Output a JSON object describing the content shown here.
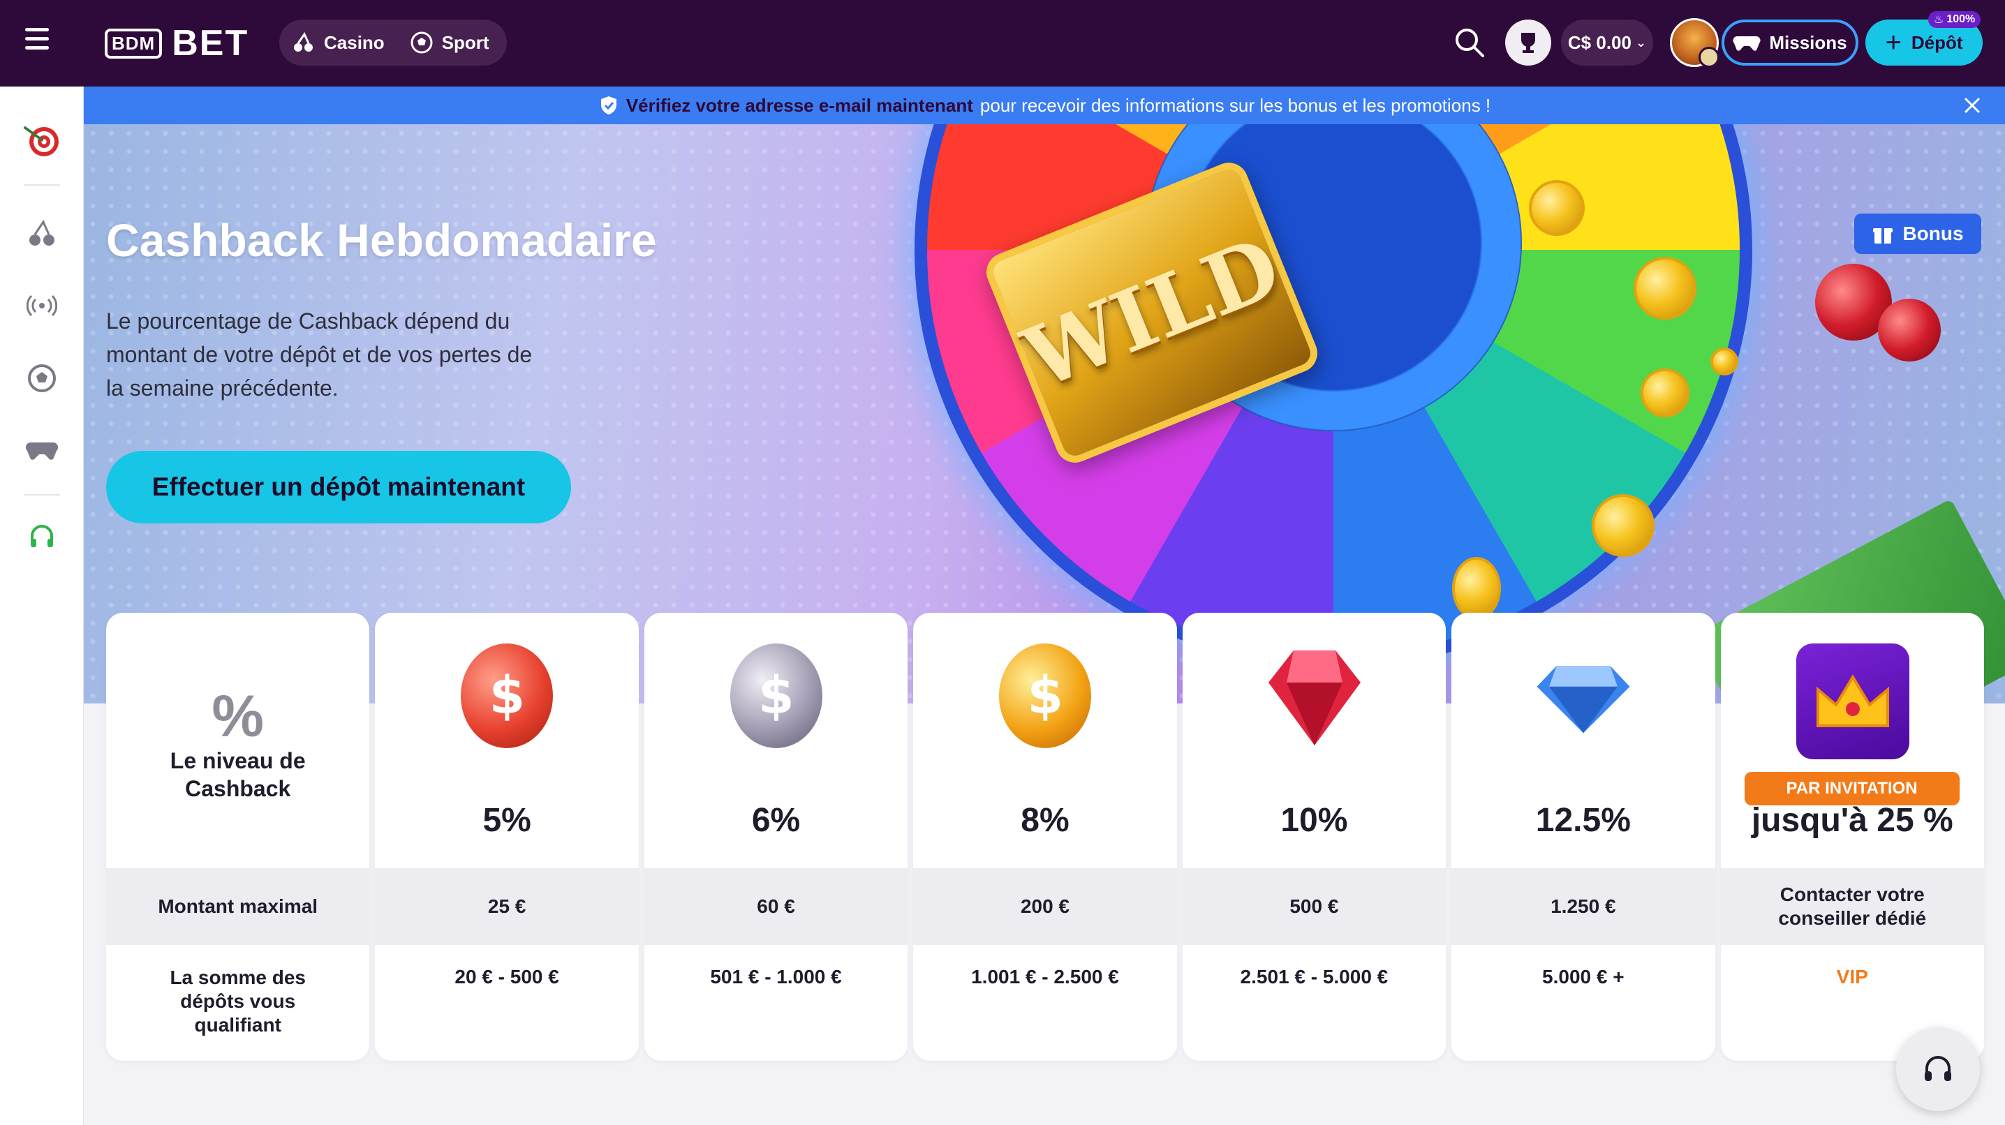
{
  "header": {
    "logo_box": "BDM",
    "logo_text": "BET",
    "nav": [
      {
        "label": "Casino",
        "icon": "cherry-icon"
      },
      {
        "label": "Sport",
        "icon": "soccer-ball-icon"
      }
    ],
    "balance": "C$ 0.00",
    "missions_label": "Missions",
    "deposit_label": "Dépôt",
    "deposit_badge": "100%"
  },
  "sidebar": {
    "items": [
      {
        "icon": "target-darts-icon"
      },
      {
        "icon": "cherry-icon"
      },
      {
        "icon": "live-broadcast-icon"
      },
      {
        "icon": "soccer-ball-icon"
      },
      {
        "icon": "gamepad-icon"
      },
      {
        "icon": "headset-icon"
      }
    ]
  },
  "notice": {
    "bold": "Vérifiez votre adresse e-mail maintenant",
    "text": "pour recevoir des informations sur les bonus et les promotions !"
  },
  "hero": {
    "title": "Cashback Hebdomadaire",
    "description": "Le pourcentage de Cashback dépend du montant de votre dépôt et de vos pertes de la semaine précédente.",
    "cta": "Effectuer un dépôt maintenant",
    "bonus_label": "Bonus",
    "wild_text": "WILD"
  },
  "table": {
    "label_symbol": "%",
    "label_level": "Le niveau de Cashback",
    "label_max": "Montant maximal",
    "label_sum": "La somme des dépôts vous qualifiant",
    "tiers": [
      {
        "percent": "5%",
        "max": "25 €",
        "range": "20 € - 500 €",
        "icon": "red-coin-icon",
        "color": "#e8412f"
      },
      {
        "percent": "6%",
        "max": "60 €",
        "range": "501 € - 1.000 €",
        "icon": "silver-coin-icon",
        "color": "#8f8aa0"
      },
      {
        "percent": "8%",
        "max": "200 €",
        "range": "1.001 € - 2.500 €",
        "icon": "gold-coin-icon",
        "color": "#f3a314"
      },
      {
        "percent": "10%",
        "max": "500 €",
        "range": "2.501 € - 5.000 €",
        "icon": "ruby-gem-icon",
        "color": "#e0243f"
      },
      {
        "percent": "12.5%",
        "max": "1.250 €",
        "range": "5.000 € +",
        "icon": "diamond-icon",
        "color": "#3a84f0"
      }
    ],
    "vip": {
      "badge": "PAR INVITATION",
      "percent": "jusqu'à 25 %",
      "max": "Contacter votre conseiller dédié",
      "range": "VIP",
      "icon": "crown-icon"
    }
  },
  "colors": {
    "topbar": "#2e0a3a",
    "accent": "#17c6e6",
    "notice": "#3a7cf2",
    "vip": "#f37a18"
  }
}
